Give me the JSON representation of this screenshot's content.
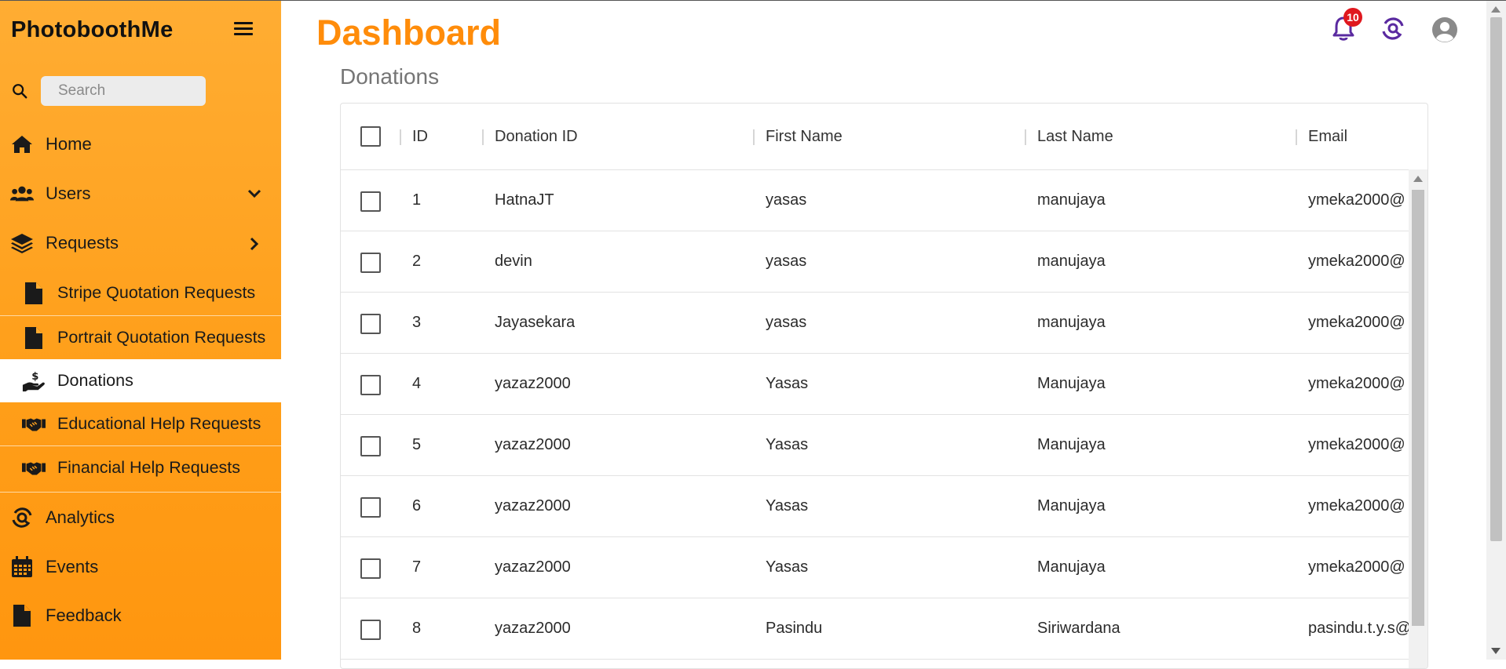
{
  "app": {
    "brand": "PhotoboothMe"
  },
  "search": {
    "placeholder": "Search"
  },
  "sidebar": {
    "items": [
      {
        "label": "Home"
      },
      {
        "label": "Users"
      },
      {
        "label": "Requests"
      },
      {
        "label": "Stripe Quotation Requests"
      },
      {
        "label": "Portrait Quotation Requests"
      },
      {
        "label": "Donations"
      },
      {
        "label": "Educational Help Requests"
      },
      {
        "label": "Financial Help Requests"
      },
      {
        "label": "Analytics"
      },
      {
        "label": "Events"
      },
      {
        "label": "Feedback"
      }
    ],
    "active": "Donations"
  },
  "header": {
    "title": "Dashboard",
    "notification_count": "10",
    "icons": [
      "bell-icon",
      "analytics-icon",
      "account-icon"
    ],
    "accent_color": "#ff8c0a",
    "badge_color": "#e0181f",
    "icon_color": "#5a2aa0"
  },
  "main": {
    "section_title": "Donations",
    "table": {
      "columns": [
        "ID",
        "Donation ID",
        "First Name",
        "Last Name",
        "Email"
      ],
      "rows": [
        [
          "1",
          "HatnaJT",
          "yasas",
          "manujaya",
          "ymeka2000@"
        ],
        [
          "2",
          "devin",
          "yasas",
          "manujaya",
          "ymeka2000@"
        ],
        [
          "3",
          "Jayasekara",
          "yasas",
          "manujaya",
          "ymeka2000@"
        ],
        [
          "4",
          "yazaz2000",
          "Yasas",
          "Manujaya",
          "ymeka2000@"
        ],
        [
          "5",
          "yazaz2000",
          "Yasas",
          "Manujaya",
          "ymeka2000@"
        ],
        [
          "6",
          "yazaz2000",
          "Yasas",
          "Manujaya",
          "ymeka2000@"
        ],
        [
          "7",
          "yazaz2000",
          "Yasas",
          "Manujaya",
          "ymeka2000@"
        ],
        [
          "8",
          "yazaz2000",
          "Pasindu",
          "Siriwardana",
          "pasindu.t.y.s@"
        ]
      ]
    }
  }
}
